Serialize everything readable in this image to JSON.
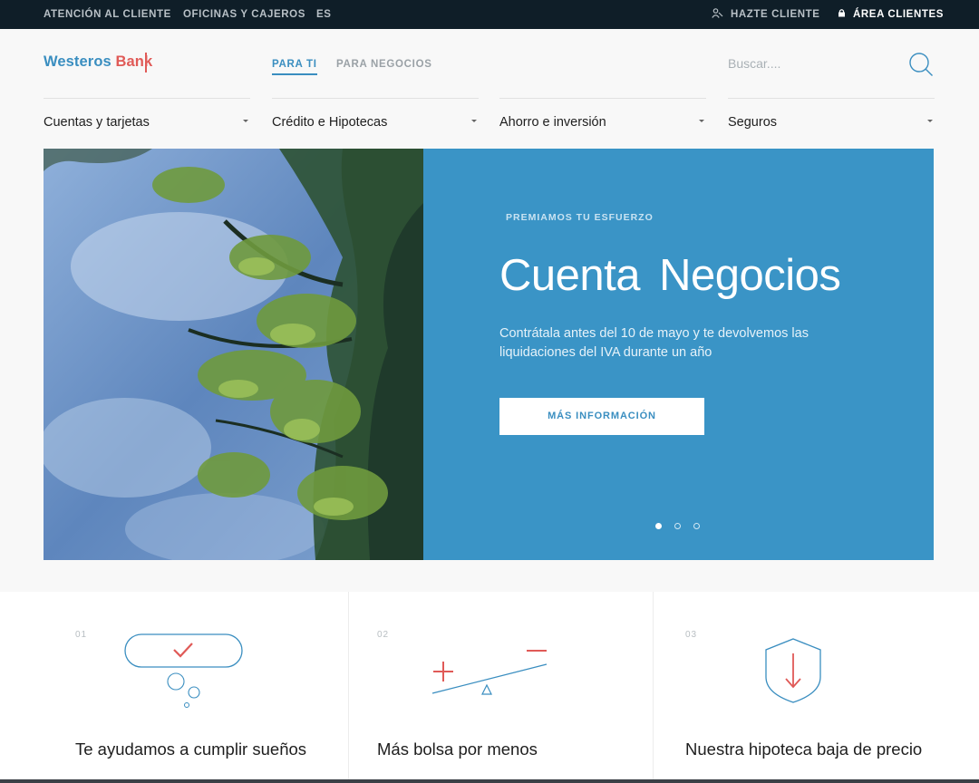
{
  "topbar": {
    "customer_service": "ATENCIÓN AL CLIENTE",
    "offices": "OFICINAS Y CAJEROS",
    "language": "ES",
    "become_client": "HAZTE CLIENTE",
    "client_area": "ÁREA CLIENTES",
    "icons": [
      "person-icon",
      "lock-icon"
    ]
  },
  "header": {
    "logo_part1": "Westeros",
    "logo_part2": "Bank",
    "segments": [
      "PARA TI",
      "PARA NEGOCIOS"
    ],
    "active_segment": "PARA TI",
    "search_placeholder": "Buscar....",
    "categories": [
      "Cuentas y tarjetas",
      "Crédito e Hipotecas",
      "Ahorro e inversión",
      "Seguros"
    ]
  },
  "hero": {
    "eyebrow": "PREMIAMOS TU ESFUERZO",
    "title": "Cuenta  Negocios",
    "text": "Contrátala antes del 10 de mayo y te devolvemos las liquidaciones del IVA durante un año",
    "cta": "MÁS INFORMACIÓN",
    "slides": 3,
    "active_slide": 1
  },
  "features": [
    {
      "num": "01",
      "title": "Te ayudamos a cumplir sueños",
      "icon": "checkmark-bubble-icon"
    },
    {
      "num": "02",
      "title": "Más bolsa por menos",
      "icon": "balance-plus-minus-icon"
    },
    {
      "num": "03",
      "title": "Nuestra hipoteca baja de precio",
      "icon": "shield-down-arrow-icon"
    }
  ],
  "colors": {
    "brand_blue": "#3a8ec0",
    "brand_red": "#e05a57",
    "hero_panel": "#3a94c6",
    "topbar_bg": "#0f1e28"
  }
}
